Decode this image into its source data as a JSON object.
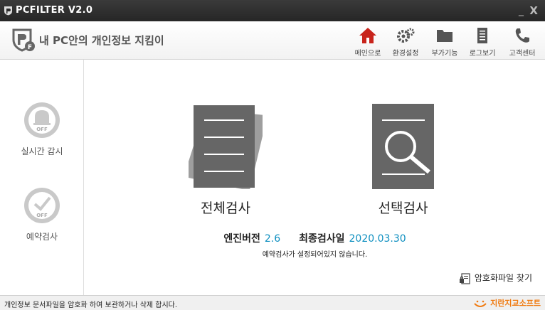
{
  "window": {
    "title": "PCFILTER V2.0",
    "minimize": "_",
    "close": "X"
  },
  "header": {
    "brand": "내 PC안의 개인정보 지킴이",
    "nav": [
      {
        "label": "메인으로",
        "icon": "home-icon"
      },
      {
        "label": "환경설정",
        "icon": "settings-icon"
      },
      {
        "label": "부가기능",
        "icon": "folder-icon"
      },
      {
        "label": "로그보기",
        "icon": "log-icon"
      },
      {
        "label": "고객센터",
        "icon": "phone-icon"
      }
    ]
  },
  "sidebar": {
    "items": [
      {
        "label": "실시간 감시",
        "status": "OFF",
        "icon": "bell-icon"
      },
      {
        "label": "예약검사",
        "status": "OFF",
        "icon": "clock-icon"
      }
    ]
  },
  "main": {
    "full_scan_label": "전체검사",
    "select_scan_label": "선택검사",
    "engine_label": "엔진버전",
    "engine_version": "2.6",
    "last_scan_label": "최종검사일",
    "last_scan_date": "2020.03.30",
    "schedule_notice": "예약검사가 설정되어있지 않습니다.",
    "find_encrypted_label": "암호화파일 찾기"
  },
  "statusbar": {
    "message": "개인정보 문서파일을 암호화 하여 보관하거나 삭제 합시다.",
    "company": "지란지교소프트"
  },
  "colors": {
    "accent_red": "#c8241c",
    "value_blue": "#0e8fc0",
    "company_orange": "#f07a10",
    "icon_gray": "#6a6a6a"
  }
}
